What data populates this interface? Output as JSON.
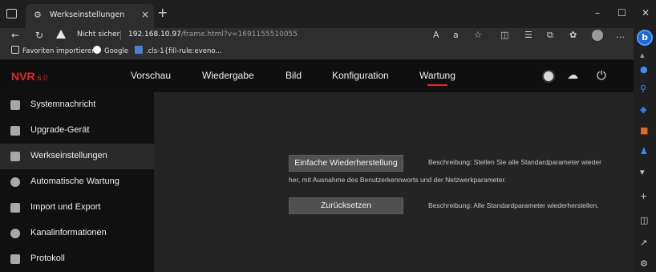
{
  "browser": {
    "tab_title": "Werkseinstellungen",
    "tab_close": "×",
    "new_tab": "+",
    "window_controls": [
      "–",
      "☐",
      "✕"
    ],
    "security_label": "Nicht sicher",
    "url_host": "192.168.10.97",
    "url_path": "/frame.html?v=1691155510055",
    "favorites": [
      {
        "label": "Favoriten importieren",
        "icon": "import-icon"
      },
      {
        "label": "Google",
        "icon": "google-icon"
      },
      {
        "label": ".cls-1{fill-rule:eveno...",
        "icon": "page-icon"
      }
    ]
  },
  "app": {
    "logo": "NVR",
    "logo_version": "6.0",
    "nav": [
      "Vorschau",
      "Wiedergabe",
      "Bild",
      "Konfiguration",
      "Wartung"
    ],
    "active_nav": "Wartung",
    "accent_color": "#e5262b"
  },
  "sidebar": {
    "items": [
      {
        "label": "Systemnachricht",
        "icon": "info-list-icon"
      },
      {
        "label": "Upgrade-Gerät",
        "icon": "upgrade-icon"
      },
      {
        "label": "Werkseinstellungen",
        "icon": "factory-reset-icon"
      },
      {
        "label": "Automatische Wartung",
        "icon": "gear-icon"
      },
      {
        "label": "Import und Export",
        "icon": "import-export-icon"
      },
      {
        "label": "Kanalinformationen",
        "icon": "info-icon"
      },
      {
        "label": "Protokoll",
        "icon": "log-icon"
      }
    ],
    "active": "Werkseinstellungen"
  },
  "content": {
    "simple_restore_label": "Einfache Wiederherstellung",
    "simple_restore_desc_1": "Beschreibung: Stellen Sie alle Standardparameter wieder",
    "simple_restore_desc_2": "her, mit Ausnahme des Benutzerkennworts und der Netzwerkparameter.",
    "reset_label": "Zurücksetzen",
    "reset_desc": "Beschreibung: Alle Standardparameter wiederherstellen."
  }
}
